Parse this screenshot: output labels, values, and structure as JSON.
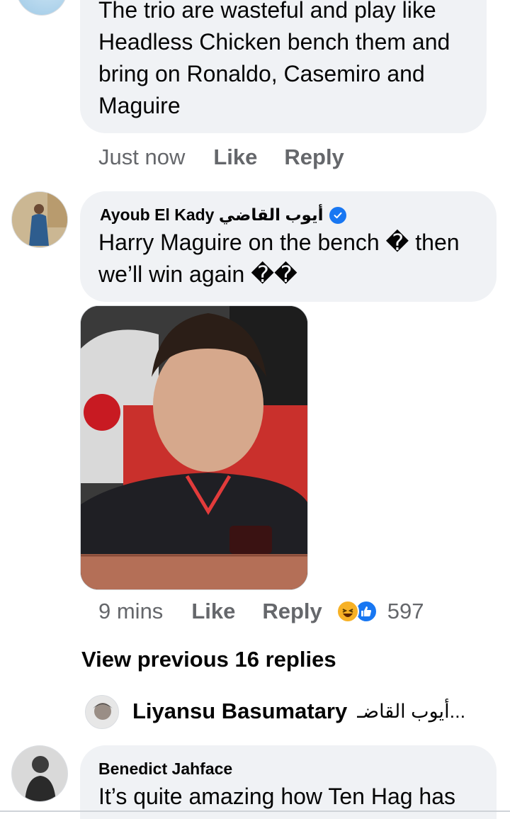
{
  "comment1": {
    "text": "The trio are wasteful and play like Headless Chicken bench them and bring on Ronaldo, Casemiro and Maguire",
    "time": "Just now",
    "like": "Like",
    "reply": "Reply"
  },
  "comment2": {
    "author": "Ayoub El Kady أيوب القاضي",
    "text": "Harry Maguire on the bench � then we’ll win again ��",
    "time": "9 mins",
    "like": "Like",
    "reply": "Reply",
    "reaction_count": "597",
    "reaction_icons": [
      "laughing-reaction-icon",
      "like-reaction-icon"
    ]
  },
  "view_previous": "View previous 16 replies",
  "reply_preview": {
    "author": "Liyansu Basumatary",
    "snippet": "أيوب القاضـ..."
  },
  "comment3": {
    "author": "Benedict Jahface",
    "text": "It’s quite amazing how Ten Hag has"
  },
  "colors": {
    "bubble": "#f0f2f5",
    "secondary_text": "#65676b",
    "verified_blue": "#1877f2"
  }
}
